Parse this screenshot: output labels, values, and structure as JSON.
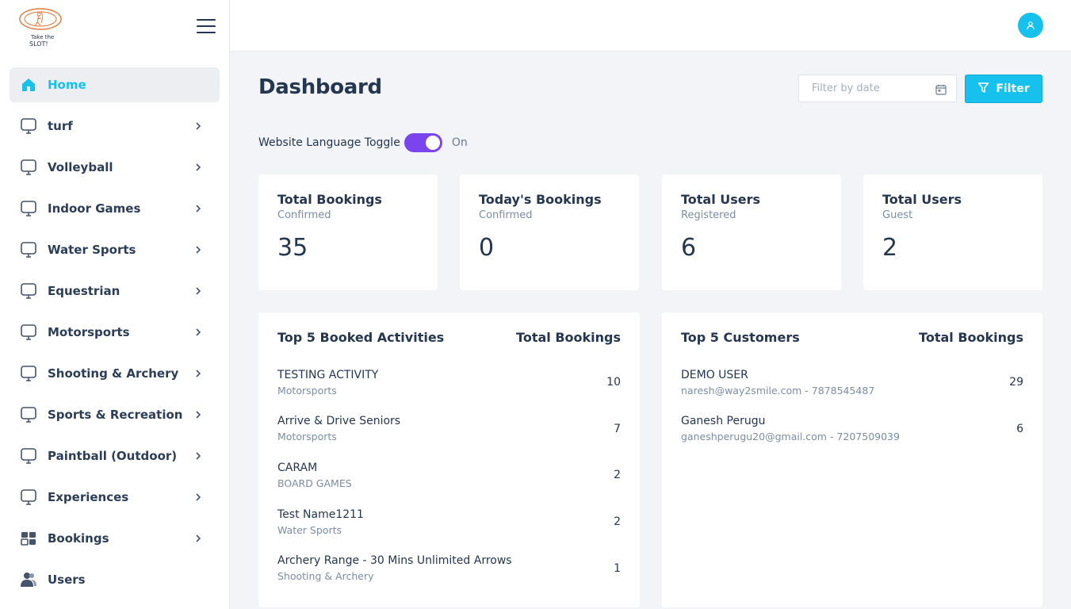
{
  "brand": {
    "logo_text_line1": "Take the",
    "logo_text_line2": "SLOT!"
  },
  "sidebar": {
    "items": [
      {
        "label": "Home",
        "icon": "home-icon",
        "active": true,
        "chevron": false
      },
      {
        "label": "turf",
        "icon": "monitor-icon",
        "chevron": true
      },
      {
        "label": "Volleyball",
        "icon": "monitor-icon",
        "chevron": true
      },
      {
        "label": "Indoor Games",
        "icon": "monitor-icon",
        "chevron": true
      },
      {
        "label": "Water Sports",
        "icon": "monitor-icon",
        "chevron": true
      },
      {
        "label": "Equestrian",
        "icon": "monitor-icon",
        "chevron": true
      },
      {
        "label": "Motorsports",
        "icon": "monitor-icon",
        "chevron": true
      },
      {
        "label": "Shooting & Archery",
        "icon": "monitor-icon",
        "chevron": true
      },
      {
        "label": "Sports & Recreation",
        "icon": "monitor-icon",
        "chevron": true
      },
      {
        "label": "Paintball (Outdoor)",
        "icon": "monitor-icon",
        "chevron": true
      },
      {
        "label": "Experiences",
        "icon": "monitor-icon",
        "chevron": true
      },
      {
        "label": "Bookings",
        "icon": "grid-icon",
        "chevron": true
      },
      {
        "label": "Users",
        "icon": "users-icon",
        "chevron": false
      }
    ]
  },
  "header": {
    "avatar_icon": "user-icon"
  },
  "main": {
    "title": "Dashboard",
    "date_filter": {
      "placeholder": "Filter by date",
      "value": ""
    },
    "filter_button": "Filter",
    "language_toggle": {
      "label": "Website Language Toggle",
      "state": "On",
      "enabled": true
    },
    "stats": [
      {
        "title": "Total Bookings",
        "subtitle": "Confirmed",
        "value": "35"
      },
      {
        "title": "Today's Bookings",
        "subtitle": "Confirmed",
        "value": "0"
      },
      {
        "title": "Total Users",
        "subtitle": "Registered",
        "value": "6"
      },
      {
        "title": "Total Users",
        "subtitle": "Guest",
        "value": "2"
      }
    ],
    "top_activities": {
      "title": "Top 5 Booked Activities",
      "column": "Total Bookings",
      "rows": [
        {
          "name": "TESTING ACTIVITY",
          "category": "Motorsports",
          "count": "10"
        },
        {
          "name": "Arrive & Drive Seniors",
          "category": "Motorsports",
          "count": "7"
        },
        {
          "name": "CARAM",
          "category": "BOARD GAMES",
          "count": "2"
        },
        {
          "name": "Test Name1211",
          "category": "Water Sports",
          "count": "2"
        },
        {
          "name": "Archery Range - 30 Mins Unlimited Arrows",
          "category": "Shooting & Archery",
          "count": "1"
        }
      ]
    },
    "top_customers": {
      "title": "Top 5 Customers",
      "column": "Total Bookings",
      "rows": [
        {
          "name": "DEMO USER",
          "contact": "naresh@way2smile.com - 7878545487",
          "count": "29"
        },
        {
          "name": "Ganesh Perugu",
          "contact": "ganeshperugu20@gmail.com - 7207509039",
          "count": "6"
        }
      ]
    }
  },
  "colors": {
    "accent": "#16c1ee",
    "toggle": "#7a45ee",
    "text": "#253650",
    "muted": "#7c8da6"
  }
}
